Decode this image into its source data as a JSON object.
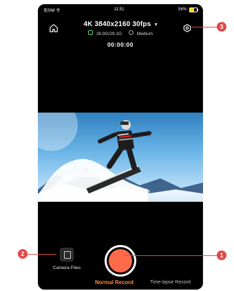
{
  "status_bar": {
    "left_text": "无SIM 令",
    "time": "11:51",
    "battery_text": "54%"
  },
  "header": {
    "title": "4K 3840x2160 30fps",
    "title_chevron": "▾",
    "storage": "28.9G/29.1G",
    "quality": "Medium",
    "timer": "00:00:00"
  },
  "controls": {
    "camera_files_label": "Camera Files",
    "mode_normal": "Normal Record",
    "mode_timelapse": "Time-lapse Record"
  },
  "callouts": [
    "1",
    "2",
    "3"
  ],
  "colors": {
    "record": "#ff6a4a",
    "mode_active": "#ff8a3d",
    "callout": "#e04848"
  },
  "icons": {
    "home": "home-icon",
    "settings": "settings-icon",
    "files": "camera-files-icon"
  }
}
